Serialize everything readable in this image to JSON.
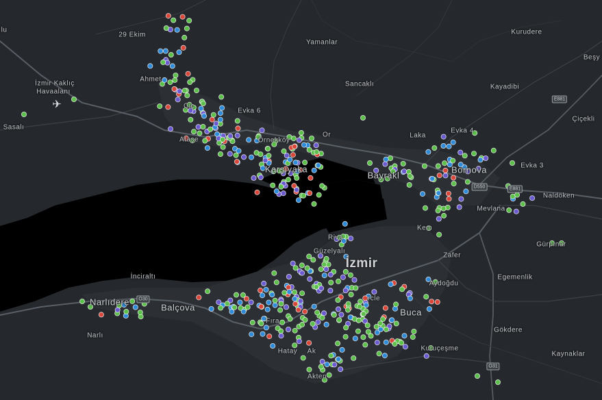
{
  "map": {
    "theme": "dark",
    "colors": {
      "land": "#25282c",
      "water": "#000000",
      "urban": "#2f3337",
      "road_major": "#4a4f55",
      "road_minor": "#363a3f",
      "marker_green": "#5dc04b",
      "marker_blue": "#2f8bd8",
      "marker_purple": "#6c5bd0",
      "marker_red": "#d9473a"
    },
    "labels": [
      {
        "id": "ulu",
        "text": "lu",
        "size": "small"
      },
      {
        "id": "29-ekim",
        "text": "29 Ekim",
        "size": "small"
      },
      {
        "id": "yamanlar",
        "text": "Yamanlar",
        "size": "small"
      },
      {
        "id": "kurudere",
        "text": "Kurudere",
        "size": "small"
      },
      {
        "id": "besy",
        "text": "Beşy",
        "size": "small"
      },
      {
        "id": "izmir-airport-1",
        "text": "İzmir Kaklıç",
        "size": "small"
      },
      {
        "id": "izmir-airport-2",
        "text": "Havaalanı",
        "size": "small"
      },
      {
        "id": "ahmet",
        "text": "Ahmet",
        "size": "small"
      },
      {
        "id": "sancakli",
        "text": "Sancaklı",
        "size": "small"
      },
      {
        "id": "kayadibi",
        "text": "Kayadibi",
        "size": "small"
      },
      {
        "id": "cicekli",
        "text": "Çiçekli",
        "size": "small"
      },
      {
        "id": "sasali",
        "text": "Sasalı",
        "size": "small"
      },
      {
        "id": "cigli",
        "text": "Çiç",
        "size": "small"
      },
      {
        "id": "evka6",
        "text": "Evka 6",
        "size": "small"
      },
      {
        "id": "ornekkoy",
        "text": "Örnekköy",
        "size": "small"
      },
      {
        "id": "ataser",
        "text": "Ataşe",
        "size": "small"
      },
      {
        "id": "ocak",
        "text": "Or",
        "size": "small"
      },
      {
        "id": "laka",
        "text": "Laka",
        "size": "small"
      },
      {
        "id": "evka4",
        "text": "Evka 4",
        "size": "small"
      },
      {
        "id": "bornova",
        "text": "Bornova",
        "size": "medium"
      },
      {
        "id": "evka3",
        "text": "Evka 3",
        "size": "small"
      },
      {
        "id": "bayrakli",
        "text": "Bayrakl",
        "size": "medium"
      },
      {
        "id": "karsiyaka",
        "text": "Karşıyaka",
        "size": "medium"
      },
      {
        "id": "naldoken",
        "text": "Naldöken",
        "size": "small"
      },
      {
        "id": "mevlana",
        "text": "Mevlana",
        "size": "small"
      },
      {
        "id": "gurpinar",
        "text": "Gürpınar",
        "size": "small"
      },
      {
        "id": "kemalpasa",
        "text": "Kem",
        "size": "small"
      },
      {
        "id": "riva",
        "text": "Riva",
        "size": "small"
      },
      {
        "id": "zafer",
        "text": "Zafer",
        "size": "small"
      },
      {
        "id": "guzelyali",
        "text": "Güzelyalı",
        "size": "small"
      },
      {
        "id": "izmir",
        "text": "İzmir",
        "size": "large"
      },
      {
        "id": "inciralti",
        "text": "İnciraltı",
        "size": "small"
      },
      {
        "id": "aydogdu",
        "text": "Aydoğdu",
        "size": "small"
      },
      {
        "id": "egemenlik",
        "text": "Egemenlik",
        "size": "small"
      },
      {
        "id": "narlidere",
        "text": "Narlıdere",
        "size": "medium"
      },
      {
        "id": "balcova",
        "text": "Balçova",
        "size": "medium"
      },
      {
        "id": "buca",
        "text": "Buca",
        "size": "medium"
      },
      {
        "id": "circle",
        "text": "rcle",
        "size": "small"
      },
      {
        "id": "narli",
        "text": "Narlı",
        "size": "small"
      },
      {
        "id": "gokdere",
        "text": "Gökdere",
        "size": "small"
      },
      {
        "id": "kurucesme",
        "text": "Kuruçeşme",
        "size": "small"
      },
      {
        "id": "firat",
        "text": "Fıra",
        "size": "small"
      },
      {
        "id": "kaynaklar",
        "text": "Kaynaklar",
        "size": "small"
      },
      {
        "id": "akten",
        "text": "Akten",
        "size": "small"
      },
      {
        "id": "hatay",
        "text": "Hatay",
        "size": "small"
      },
      {
        "id": "tarsak",
        "text": "Ak",
        "size": "small"
      }
    ],
    "shields": [
      {
        "id": "e881-top",
        "text": "E881"
      },
      {
        "id": "d550",
        "text": "D550"
      },
      {
        "id": "e881-mid",
        "text": "E881"
      },
      {
        "id": "o30",
        "text": "O30"
      },
      {
        "id": "o31",
        "text": "O31"
      }
    ],
    "airport_icon": "airplane-icon"
  }
}
